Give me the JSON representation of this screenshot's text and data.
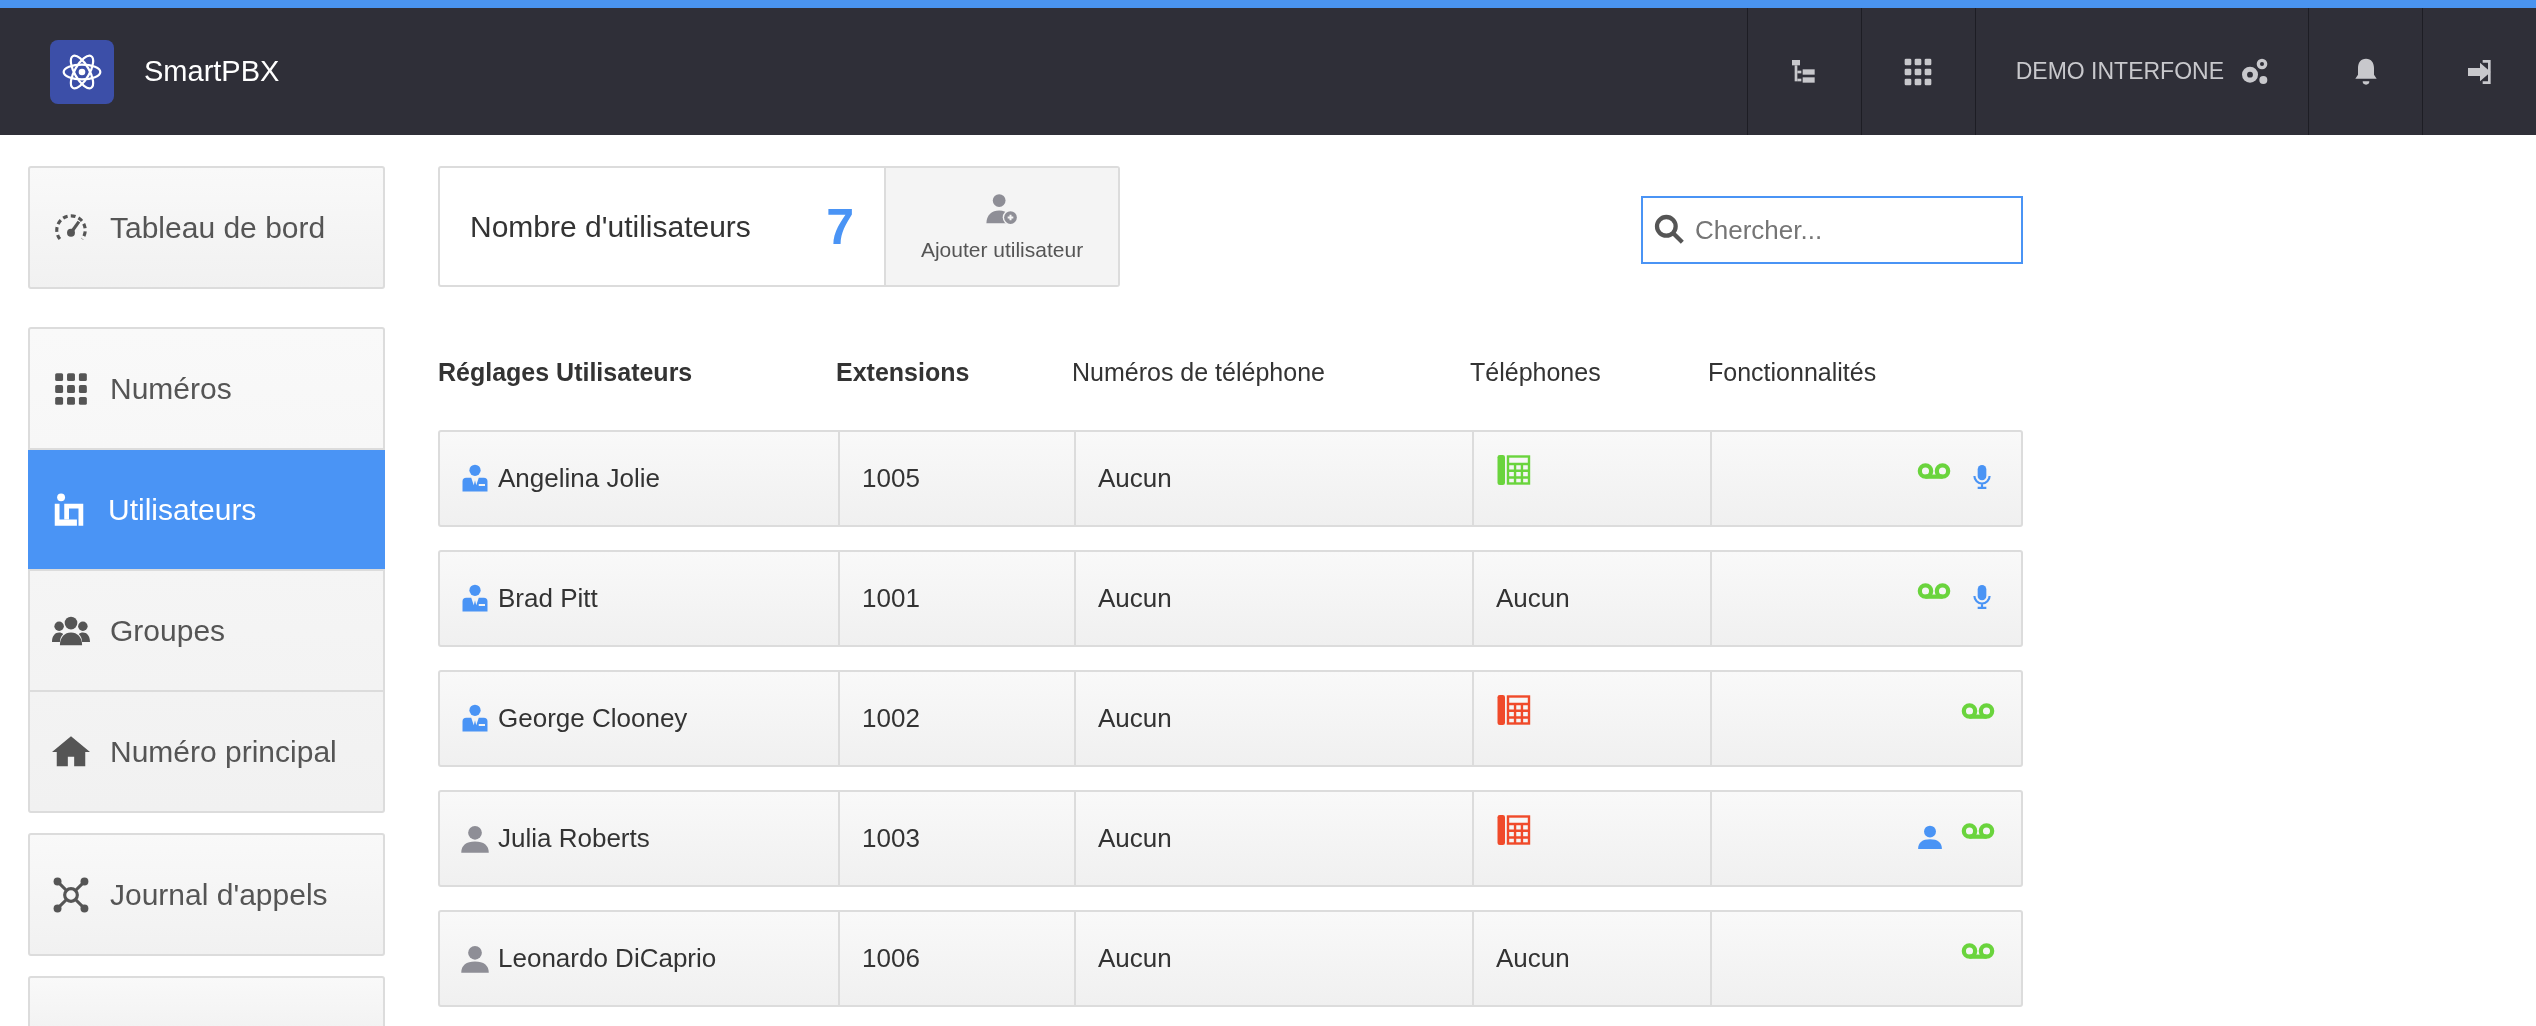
{
  "header": {
    "app_name": "SmartPBX",
    "account": "DEMO INTERFONE"
  },
  "sidebar": {
    "groups": [
      {
        "items": [
          {
            "label": "Tableau de bord",
            "selected": false
          }
        ]
      },
      {
        "items": [
          {
            "label": "Numéros",
            "selected": false
          },
          {
            "label": "Utilisateurs",
            "selected": true
          },
          {
            "label": "Groupes",
            "selected": false
          },
          {
            "label": "Numéro principal",
            "selected": false
          }
        ]
      },
      {
        "items": [
          {
            "label": "Journal d'appels",
            "selected": false
          }
        ]
      }
    ]
  },
  "counter": {
    "label": "Nombre d'utilisateurs",
    "count": "7"
  },
  "add_button": {
    "label": "Ajouter utilisateur"
  },
  "search": {
    "placeholder": "Chercher..."
  },
  "table": {
    "columns": [
      {
        "label": "Réglages Utilisateurs"
      },
      {
        "label": "Extensions"
      },
      {
        "label": "Numéros de téléphone"
      },
      {
        "label": "Téléphones"
      },
      {
        "label": "Fonctionnalités"
      }
    ],
    "rows": [
      {
        "name": "Angelina Jolie",
        "kind": "admin",
        "extension": "1005",
        "numbers": "Aucun",
        "phone": {
          "kind": "device",
          "color": "#6ad43d"
        },
        "features": [
          {
            "kind": "voicemail"
          },
          {
            "kind": "microphone"
          }
        ]
      },
      {
        "name": "Brad Pitt",
        "kind": "admin",
        "extension": "1001",
        "numbers": "Aucun",
        "phone": {
          "kind": "text",
          "text": "Aucun"
        },
        "features": [
          {
            "kind": "voicemail"
          },
          {
            "kind": "microphone"
          }
        ]
      },
      {
        "name": "George Clooney",
        "kind": "admin",
        "extension": "1002",
        "numbers": "Aucun",
        "phone": {
          "kind": "device",
          "color": "#f04a2a"
        },
        "features": [
          {
            "kind": "voicemail"
          }
        ]
      },
      {
        "name": "Julia Roberts",
        "kind": "user",
        "extension": "1003",
        "numbers": "Aucun",
        "phone": {
          "kind": "device",
          "color": "#f04a2a"
        },
        "features": [
          {
            "kind": "user"
          },
          {
            "kind": "voicemail"
          }
        ]
      },
      {
        "name": "Leonardo DiCaprio",
        "kind": "user",
        "extension": "1006",
        "numbers": "Aucun",
        "phone": {
          "kind": "text",
          "text": "Aucun"
        },
        "features": [
          {
            "kind": "voicemail"
          }
        ]
      }
    ]
  }
}
